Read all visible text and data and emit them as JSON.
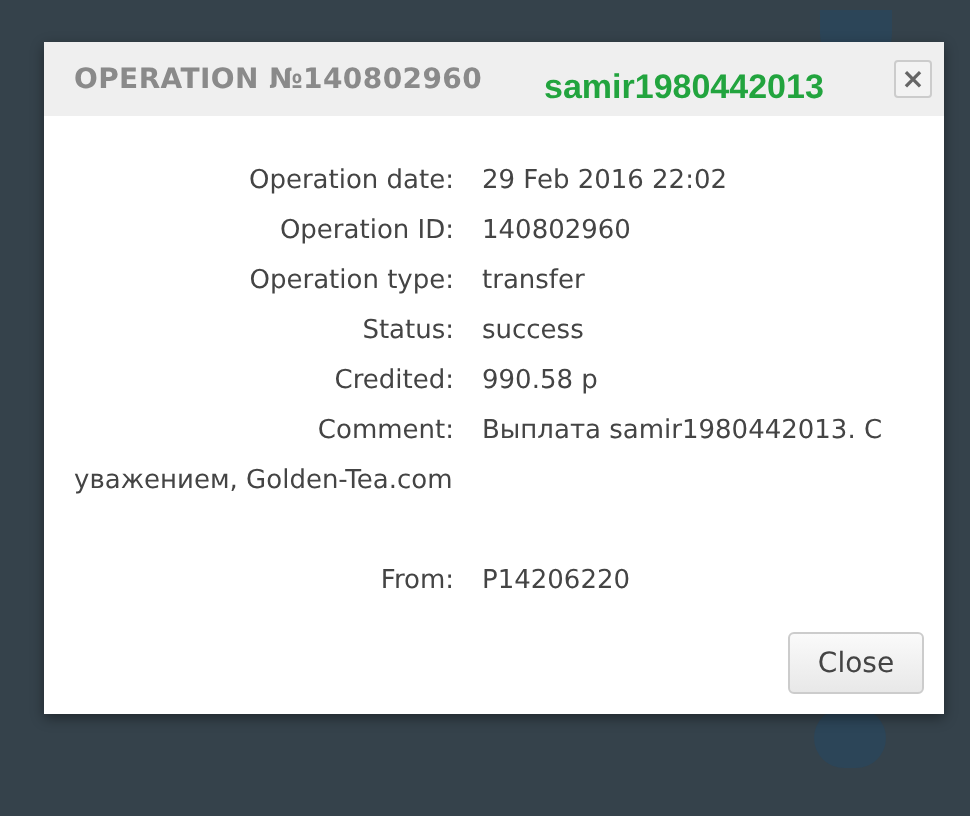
{
  "dialog": {
    "title": "OPERATION №140802960",
    "overlay_note": "samir1980442013",
    "close_icon": "×",
    "fields": [
      {
        "label": "Operation date:",
        "value": "29 Feb 2016 22:02"
      },
      {
        "label": "Operation ID:",
        "value": "140802960"
      },
      {
        "label": "Operation type:",
        "value": "transfer"
      },
      {
        "label": "Status:",
        "value": "success"
      },
      {
        "label": "Credited:",
        "value": "990.58 р"
      },
      {
        "label": "Comment:",
        "value": "Выплата samir1980442013. С уважением, Golden-Tea.com"
      },
      {
        "label": "From:",
        "value": "P14206220"
      }
    ],
    "buttons": [
      "Close"
    ]
  }
}
